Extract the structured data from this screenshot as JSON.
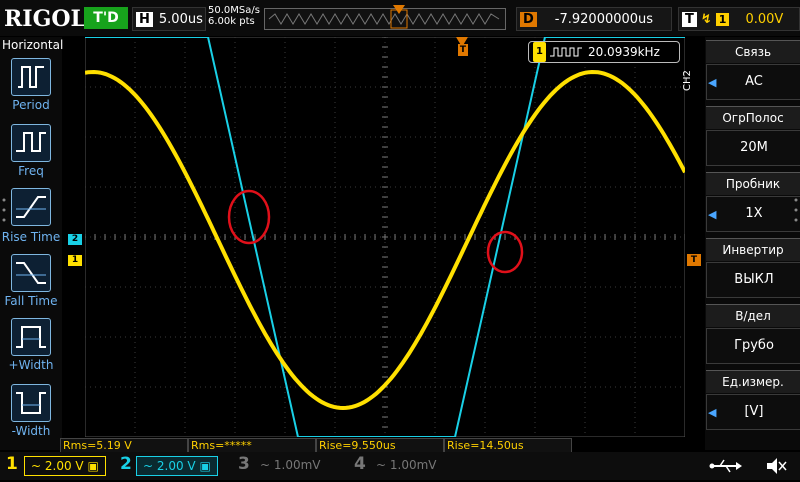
{
  "brand": "RIGOL",
  "status": {
    "run_state": "T'D"
  },
  "horizontal": {
    "key": "H",
    "timebase": "5.00us",
    "sample_rate": "50.0MSa/s",
    "points": "6.00k pts"
  },
  "delay": {
    "key": "D",
    "value": "-7.92000000us"
  },
  "trigger": {
    "key": "T",
    "source": "1",
    "level": "0.00V"
  },
  "left_menu": {
    "title": "Horizontal",
    "items": [
      {
        "label": "Period"
      },
      {
        "label": "Freq"
      },
      {
        "label": "Rise Time"
      },
      {
        "label": "Fall Time"
      },
      {
        "label": "+Width"
      },
      {
        "label": "-Width"
      }
    ]
  },
  "right_menu": {
    "channel_tab": "CH2",
    "items": [
      {
        "label": "Связь",
        "value": "AC"
      },
      {
        "label": "ОгрПолос",
        "value": "20M"
      },
      {
        "label": "Пробник",
        "value": "1X"
      },
      {
        "label": "Инвертир",
        "value": "ВЫКЛ"
      },
      {
        "label": "В/дел",
        "value": "Грубо"
      },
      {
        "label": "Ед.измер.",
        "value": "[V]"
      }
    ]
  },
  "freq_counter": {
    "channel": "1",
    "value": "20.0939kHz"
  },
  "markers": {
    "ch1": "1",
    "ch2": "2",
    "trigger": "T"
  },
  "measurements": [
    "Rms=5.19 V",
    "Rms=*****",
    "Rise=9.550us",
    "Rise=14.50us"
  ],
  "channels": [
    {
      "num": "1",
      "scale": "2.00 V",
      "color": "#ffe000"
    },
    {
      "num": "2",
      "scale": "2.00 V",
      "color": "#19d0e6"
    },
    {
      "num": "3",
      "scale": "1.00mV",
      "color": "#777777"
    },
    {
      "num": "4",
      "scale": "1.00mV",
      "color": "#777777"
    }
  ],
  "colors": {
    "ch1": "#ffe000",
    "ch2": "#19d0e6",
    "accent": "#e07800",
    "annotation": "#e0101a"
  }
}
